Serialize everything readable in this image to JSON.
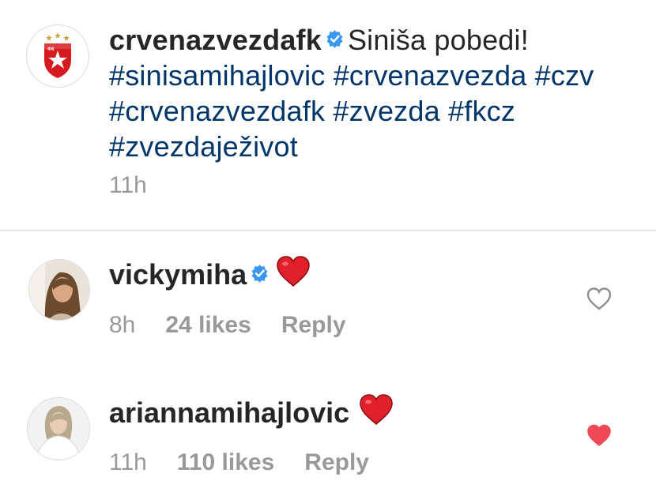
{
  "post": {
    "username": "crvenazvezdafk",
    "caption_text": "Siniša pobedi!",
    "hashtags_line1": "#sinisamihajlovic #crvenazvezda #czv",
    "hashtags_line2": "#crvenazvezdafk #zvezda #fkcz",
    "hashtags_line3": "#zvezdaježivot",
    "time": "11h"
  },
  "comments": [
    {
      "username": "vickymiha",
      "verified": true,
      "emoji": "heart-emoji",
      "time": "8h",
      "likes": "24 likes",
      "reply": "Reply",
      "liked": false
    },
    {
      "username": "ariannamihajlovic",
      "verified": false,
      "emoji": "heart-emoji",
      "time": "11h",
      "likes": "110 likes",
      "reply": "Reply",
      "liked": true
    }
  ],
  "colors": {
    "hashtag": "#003569",
    "verified": "#3897f0",
    "heart_red": "#ed4956",
    "muted_text": "#999999"
  }
}
